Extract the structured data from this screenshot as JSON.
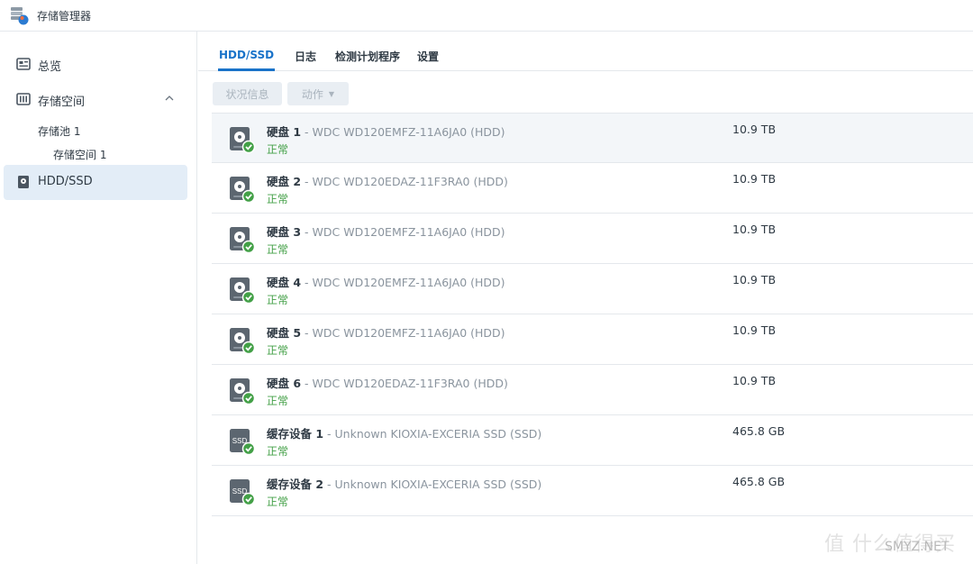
{
  "app": {
    "title": "存储管理器",
    "icon": "storage-manager-icon"
  },
  "sidebar": {
    "items": [
      {
        "label": "总览",
        "icon": "overview-icon"
      },
      {
        "label": "存储空间",
        "icon": "storage-icon"
      },
      {
        "label": "HDD/SSD",
        "icon": "disk-icon"
      }
    ],
    "pool": "存储池 1",
    "volume": "存储空间 1"
  },
  "tabs": [
    {
      "label": "HDD/SSD"
    },
    {
      "label": "日志"
    },
    {
      "label": "检测计划程序"
    },
    {
      "label": "设置"
    }
  ],
  "toolbar": {
    "status_label": "状况信息",
    "action_label": "动作"
  },
  "disks": [
    {
      "name": "硬盘 1",
      "model": " - WDC WD120EMFZ-11A6JA0 (HDD)",
      "status": "正常",
      "size": "10.9 TB",
      "icon": "hdd-icon"
    },
    {
      "name": "硬盘 2",
      "model": " - WDC WD120EDAZ-11F3RA0 (HDD)",
      "status": "正常",
      "size": "10.9 TB",
      "icon": "hdd-icon"
    },
    {
      "name": "硬盘 3",
      "model": " - WDC WD120EMFZ-11A6JA0 (HDD)",
      "status": "正常",
      "size": "10.9 TB",
      "icon": "hdd-icon"
    },
    {
      "name": "硬盘 4",
      "model": " - WDC WD120EMFZ-11A6JA0 (HDD)",
      "status": "正常",
      "size": "10.9 TB",
      "icon": "hdd-icon"
    },
    {
      "name": "硬盘 5",
      "model": " - WDC WD120EMFZ-11A6JA0 (HDD)",
      "status": "正常",
      "size": "10.9 TB",
      "icon": "hdd-icon"
    },
    {
      "name": "硬盘 6",
      "model": " - WDC WD120EDAZ-11F3RA0 (HDD)",
      "status": "正常",
      "size": "10.9 TB",
      "icon": "hdd-icon"
    },
    {
      "name": "缓存设备 1",
      "model": " - Unknown KIOXIA-EXCERIA SSD (SSD)",
      "status": "正常",
      "size": "465.8 GB",
      "icon": "ssd-icon",
      "icon_text": "SSD"
    },
    {
      "name": "缓存设备 2",
      "model": " - Unknown KIOXIA-EXCERIA SSD (SSD)",
      "status": "正常",
      "size": "465.8 GB",
      "icon": "ssd-icon",
      "icon_text": "SSD"
    }
  ],
  "watermark": {
    "text": "值 什么值得买",
    "site": "SMYZ.NET"
  },
  "colors": {
    "accent": "#1a73c9",
    "ok": "#43a047",
    "selected_nav": "#e3edf7"
  }
}
